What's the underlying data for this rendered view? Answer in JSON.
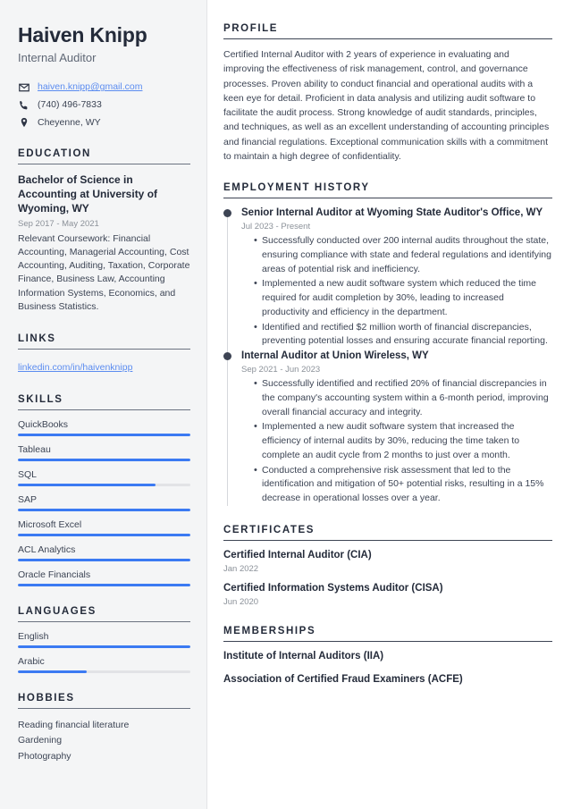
{
  "header": {
    "name": "Haiven Knipp",
    "job_title": "Internal Auditor",
    "contacts": [
      {
        "icon": "envelope-icon",
        "value": "haiven.knipp@gmail.com",
        "is_link": true
      },
      {
        "icon": "phone-icon",
        "value": "(740) 496-7833",
        "is_link": false
      },
      {
        "icon": "location-pin-icon",
        "value": "Cheyenne, WY",
        "is_link": false
      }
    ]
  },
  "sidebar": {
    "education": {
      "heading": "EDUCATION",
      "degree": "Bachelor of Science in Accounting at University of Wyoming, WY",
      "date": "Sep 2017 - May 2021",
      "description": "Relevant Coursework: Financial Accounting, Managerial Accounting, Cost Accounting, Auditing, Taxation, Corporate Finance, Business Law, Accounting Information Systems, Economics, and Business Statistics."
    },
    "links": {
      "heading": "LINKS",
      "items": [
        {
          "label": "linkedin.com/in/haivenknipp"
        }
      ]
    },
    "skills": {
      "heading": "SKILLS",
      "items": [
        {
          "label": "QuickBooks",
          "level": 100
        },
        {
          "label": "Tableau",
          "level": 100
        },
        {
          "label": "SQL",
          "level": 80
        },
        {
          "label": "SAP",
          "level": 100
        },
        {
          "label": "Microsoft Excel",
          "level": 100
        },
        {
          "label": "ACL Analytics",
          "level": 100
        },
        {
          "label": "Oracle Financials",
          "level": 100
        }
      ]
    },
    "languages": {
      "heading": "LANGUAGES",
      "items": [
        {
          "label": "English",
          "level": 100
        },
        {
          "label": "Arabic",
          "level": 40
        }
      ]
    },
    "hobbies": {
      "heading": "HOBBIES",
      "items": [
        {
          "label": "Reading financial literature"
        },
        {
          "label": "Gardening"
        },
        {
          "label": "Photography"
        }
      ]
    }
  },
  "main": {
    "profile": {
      "heading": "PROFILE",
      "text": "Certified Internal Auditor with 2 years of experience in evaluating and improving the effectiveness of risk management, control, and governance processes. Proven ability to conduct financial and operational audits with a keen eye for detail. Proficient in data analysis and utilizing audit software to facilitate the audit process. Strong knowledge of audit standards, principles, and techniques, as well as an excellent understanding of accounting principles and financial regulations. Exceptional communication skills with a commitment to maintain a high degree of confidentiality."
    },
    "employment": {
      "heading": "EMPLOYMENT HISTORY",
      "jobs": [
        {
          "title": "Senior Internal Auditor at Wyoming State Auditor's Office, WY",
          "date": "Jul 2023 - Present",
          "bullets": [
            "Successfully conducted over 200 internal audits throughout the state, ensuring compliance with state and federal regulations and identifying areas of potential risk and inefficiency.",
            "Implemented a new audit software system which reduced the time required for audit completion by 30%, leading to increased productivity and efficiency in the department.",
            "Identified and rectified $2 million worth of financial discrepancies, preventing potential losses and ensuring accurate financial reporting."
          ]
        },
        {
          "title": "Internal Auditor at Union Wireless, WY",
          "date": "Sep 2021 - Jun 2023",
          "bullets": [
            "Successfully identified and rectified 20% of financial discrepancies in the company's accounting system within a 6-month period, improving overall financial accuracy and integrity.",
            "Implemented a new audit software system that increased the efficiency of internal audits by 30%, reducing the time taken to complete an audit cycle from 2 months to just over a month.",
            "Conducted a comprehensive risk assessment that led to the identification and mitigation of 50+ potential risks, resulting in a 15% decrease in operational losses over a year."
          ]
        }
      ]
    },
    "certificates": {
      "heading": "CERTIFICATES",
      "items": [
        {
          "title": "Certified Internal Auditor (CIA)",
          "date": "Jan 2022"
        },
        {
          "title": "Certified Information Systems Auditor (CISA)",
          "date": "Jun 2020"
        }
      ]
    },
    "memberships": {
      "heading": "MEMBERSHIPS",
      "items": [
        {
          "title": "Institute of Internal Auditors (IIA)"
        },
        {
          "title": "Association of Certified Fraud Examiners (ACFE)"
        }
      ]
    }
  },
  "theme": {
    "accent": "#3b7af2",
    "link": "#5b8cf0",
    "heading": "#242b3a",
    "body_text": "#3c4454",
    "muted": "#8b9199",
    "sidebar_bg": "#f4f5f6",
    "bar_track": "#e2e3e6"
  }
}
